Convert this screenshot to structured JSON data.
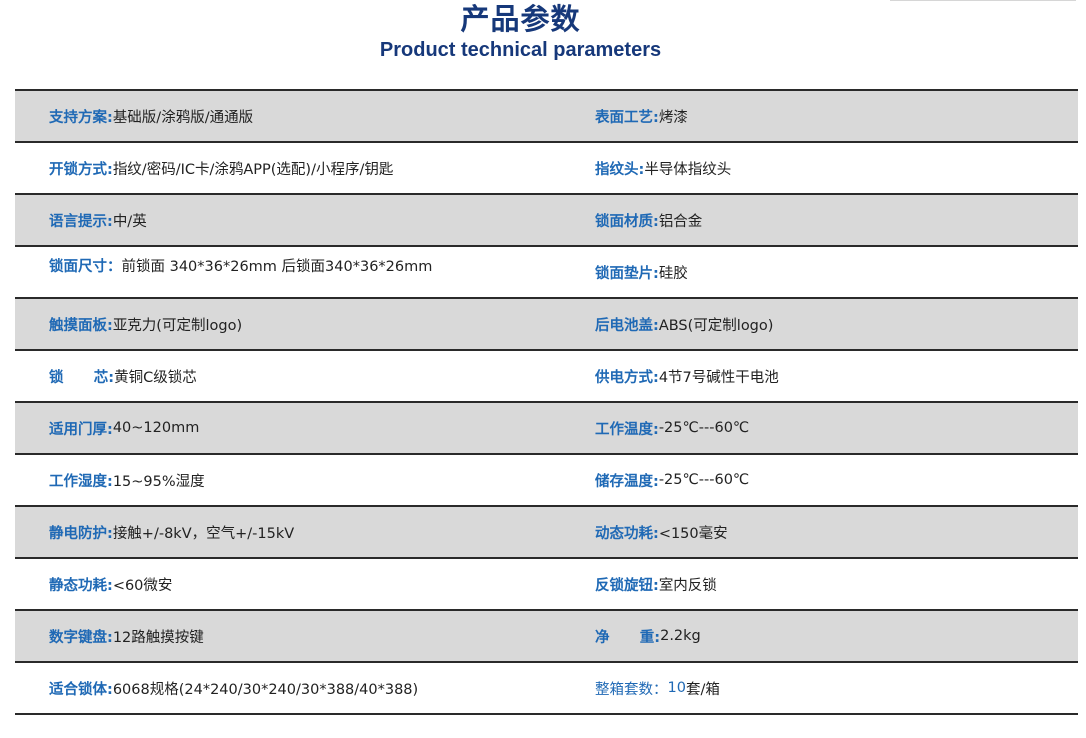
{
  "header": {
    "title_zh": "产品参数",
    "title_en": "Product technical parameters"
  },
  "rows": [
    {
      "left": {
        "key": "支持方案:",
        "value": "基础版/涂鸦版/通通版"
      },
      "right": {
        "key": "表面工艺:",
        "value": "烤漆"
      }
    },
    {
      "left": {
        "key": "开锁方式:",
        "value": "指纹/密码/IC卡/涂鸦APP(选配)/小程序/钥匙"
      },
      "right": {
        "key": "指纹头:",
        "value": "半导体指纹头"
      }
    },
    {
      "left": {
        "key": "语言提示:",
        "value": "中/英"
      },
      "right": {
        "key": "锁面材质:",
        "value": "铝合金"
      }
    },
    {
      "left": {
        "key": "锁面尺寸：",
        "value": "前锁面 340*36*26mm  后锁面340*36*26mm"
      },
      "right": {
        "key": "锁面垫片:",
        "value": "硅胶"
      }
    },
    {
      "left": {
        "key": "触摸面板:",
        "value": "亚克力(可定制logo)"
      },
      "right": {
        "key": "后电池盖:",
        "value": "ABS(可定制logo)"
      }
    },
    {
      "left": {
        "key": "锁      芯:",
        "value": "黄铜C级锁芯"
      },
      "right": {
        "key": "供电方式:",
        "value": "4节7号碱性干电池"
      }
    },
    {
      "left": {
        "key": "适用门厚:",
        "value": "40~120mm"
      },
      "right": {
        "key": "工作温度:",
        "value": "-25℃---60℃"
      }
    },
    {
      "left": {
        "key": "工作湿度:",
        "value": "15~95%湿度"
      },
      "right": {
        "key": "储存温度:",
        "value": "-25℃---60℃"
      }
    },
    {
      "left": {
        "key": "静电防护:",
        "value": "接触+/-8kV，空气+/-15kV"
      },
      "right": {
        "key": "动态功耗:",
        "value": "<150毫安"
      }
    },
    {
      "left": {
        "key": "静态功耗:",
        "value": "<60微安"
      },
      "right": {
        "key": "反锁旋钮:",
        "value": "室内反锁"
      }
    },
    {
      "left": {
        "key": "数字键盘:",
        "value": "12路触摸按键"
      },
      "right": {
        "key": "净      重:",
        "value": "2.2kg"
      }
    },
    {
      "left": {
        "key": "适合锁体:",
        "value": "6068规格(24*240/30*240/30*388/40*388)"
      },
      "right": {
        "key": "整箱套数：",
        "num": "10",
        "value": "套/箱"
      }
    }
  ],
  "colors": {
    "title": "#16387a",
    "key": "#1f69b5",
    "shaded_row": "#d9d9d9",
    "rule": "#2a2a2a"
  }
}
